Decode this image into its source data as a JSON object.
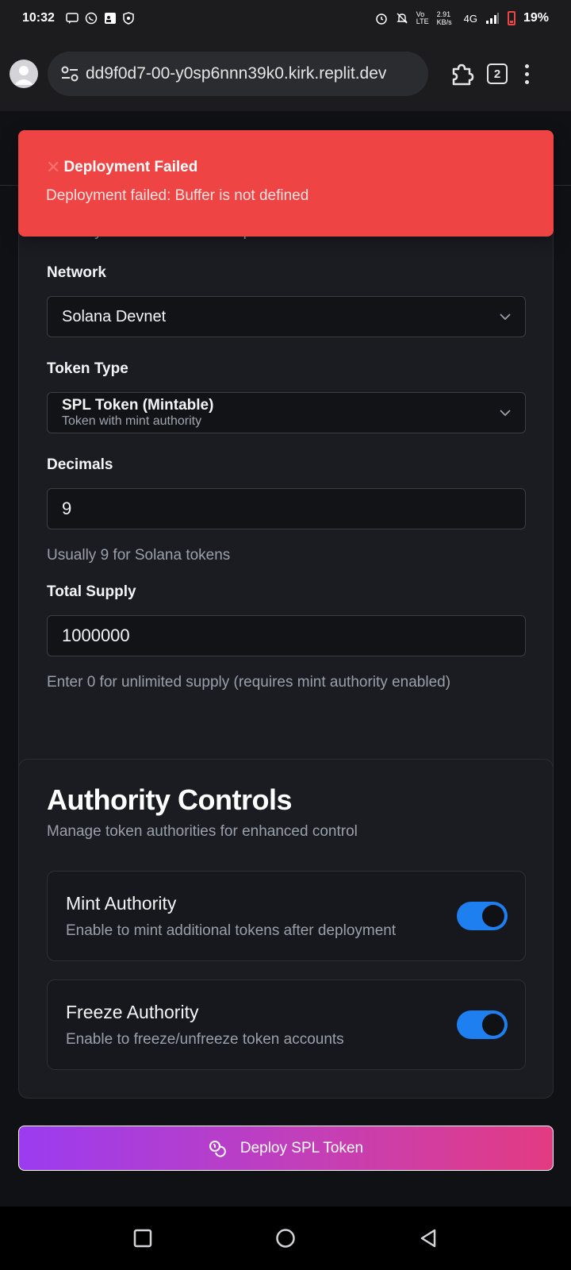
{
  "status_bar": {
    "time": "10:32",
    "network": "4G",
    "speed": "2.91 KB/s",
    "battery": "19%"
  },
  "browser": {
    "url": "dd9f0d7-00-y0sp6nnn39k0.kirk.replit.dev",
    "tab_count": "2"
  },
  "toast": {
    "title": "Deployment Failed",
    "message": "Deployment failed: Buffer is not defined"
  },
  "config_card": {
    "hidden_desc": "Define your token's technical parameters",
    "network_label": "Network",
    "network_value": "Solana Devnet",
    "token_type_label": "Token Type",
    "token_type_value": "SPL Token (Mintable)",
    "token_type_sub": "Token with mint authority",
    "decimals_label": "Decimals",
    "decimals_value": "9",
    "decimals_help": "Usually 9 for Solana tokens",
    "supply_label": "Total Supply",
    "supply_value": "1000000",
    "supply_help": "Enter 0 for unlimited supply (requires mint authority enabled)"
  },
  "authority": {
    "title": "Authority Controls",
    "desc": "Manage token authorities for enhanced control",
    "mint_title": "Mint Authority",
    "mint_desc": "Enable to mint additional tokens after deployment",
    "mint_enabled": true,
    "freeze_title": "Freeze Authority",
    "freeze_desc": "Enable to freeze/unfreeze token accounts",
    "freeze_enabled": true
  },
  "deploy_button": "Deploy SPL Token",
  "colors": {
    "toast_bg": "#ef4444",
    "toggle_on": "#1e80f0",
    "button_gradient_start": "#9b3cf0",
    "button_gradient_end": "#e33b82"
  }
}
